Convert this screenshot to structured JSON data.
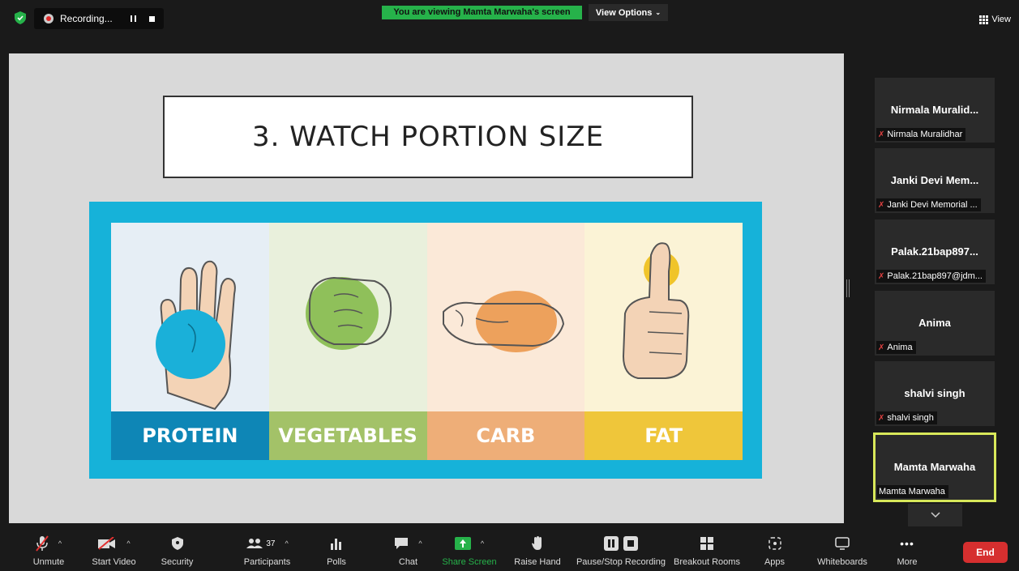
{
  "top": {
    "recording_label": "Recording...",
    "viewing_banner": "You are viewing Mamta Marwaha's screen",
    "view_options_label": "View Options",
    "view_label": "View",
    "colors": {
      "viewing_banner": "#26b24a",
      "shield": "#26b24a"
    }
  },
  "slide": {
    "title": "3. WATCH PORTION SIZE",
    "panels": [
      {
        "label": "PROTEIN",
        "bg": "#e6eef5",
        "label_bg": "#0e86b6",
        "shape": "#1ab0d9"
      },
      {
        "label": "VEGETABLES",
        "bg": "#e9f0dc",
        "label_bg": "#a3c268",
        "shape": "#8fc05a"
      },
      {
        "label": "CARB",
        "bg": "#fbe9d8",
        "label_bg": "#eeae78",
        "shape": "#eda15c"
      },
      {
        "label": "FAT",
        "bg": "#fbf3d6",
        "label_bg": "#efc63a",
        "shape": "#f0c42a"
      }
    ]
  },
  "participants": [
    {
      "name": "Nirmala Muralid...",
      "label": "Nirmala Muralidhar",
      "muted": true
    },
    {
      "name": "Janki Devi Mem...",
      "label": "Janki Devi Memorial ...",
      "muted": true
    },
    {
      "name": "Palak.21bap897...",
      "label": "Palak.21bap897@jdm...",
      "muted": true
    },
    {
      "name": "Anima",
      "label": "Anima",
      "muted": true
    },
    {
      "name": "shalvi singh",
      "label": "shalvi singh",
      "muted": true
    },
    {
      "name": "Mamta Marwaha",
      "label": "Mamta Marwaha",
      "muted": false
    }
  ],
  "toolbar": {
    "unmute": "Unmute",
    "start_video": "Start Video",
    "security": "Security",
    "participants": "Participants",
    "participants_count": "37",
    "polls": "Polls",
    "chat": "Chat",
    "share_screen": "Share Screen",
    "raise_hand": "Raise Hand",
    "pause_stop_recording": "Pause/Stop Recording",
    "breakout_rooms": "Breakout Rooms",
    "apps": "Apps",
    "whiteboards": "Whiteboards",
    "more": "More",
    "end": "End",
    "colors": {
      "share_screen": "#26b24a",
      "end": "#d62f2f"
    }
  }
}
